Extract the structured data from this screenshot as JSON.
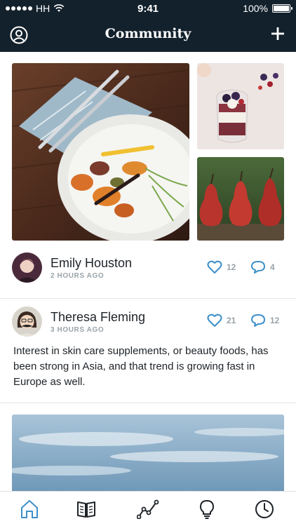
{
  "status_bar": {
    "carrier": "HH",
    "time": "9:41",
    "battery": "100%"
  },
  "header": {
    "title": "Community",
    "profile_icon": "user-circle-icon",
    "add_icon": "plus-icon"
  },
  "gallery": {
    "main_photo": "plate-of-roasted-vegetables",
    "top_photo": "berry-parfait-jar",
    "bottom_photo": "three-red-pears"
  },
  "posts": [
    {
      "name": "Emily Houston",
      "time": "2 HOURS AGO",
      "likes": "12",
      "comments": "4",
      "body": ""
    },
    {
      "name": "Theresa Fleming",
      "time": "3 HOURS AGO",
      "likes": "21",
      "comments": "12",
      "body": "Interest in skin care supplements, or beauty foods, has been strong in Asia, and that trend is growing fast in Europe as well."
    }
  ],
  "colors": {
    "header_bg": "#13212c",
    "accent": "#3d8fc9",
    "muted": "#9aa3a9"
  },
  "tabbar": {
    "items": [
      "home-icon",
      "book-icon",
      "chart-line-icon",
      "lightbulb-icon",
      "clock-icon"
    ],
    "active": "home-icon"
  }
}
